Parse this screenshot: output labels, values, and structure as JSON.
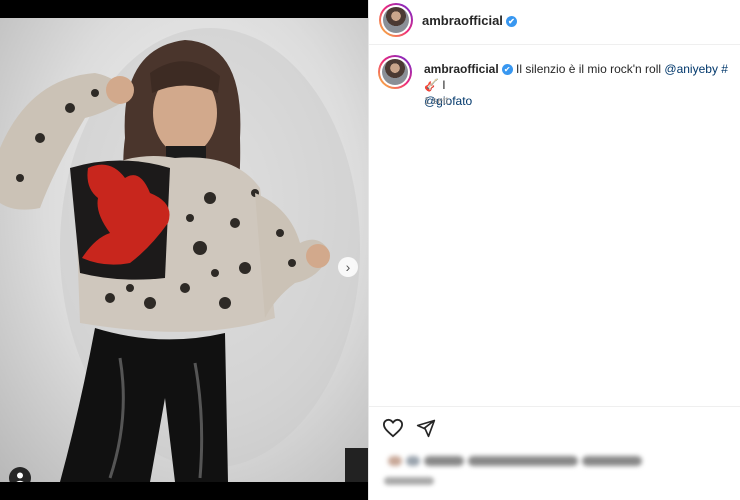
{
  "post": {
    "username": "ambraofficial",
    "verified_icon": "✔",
    "caption_text": "Il silenzio è il mio rock'n roll",
    "mention_1": "@aniyeby",
    "hashtag_start": "#",
    "emoji": "🎸",
    "mention_2": "@giofato",
    "time_ago": "1 sett."
  },
  "carousel": {
    "next_glyph": "›",
    "dot_count": 2,
    "active_dot": 0
  },
  "icons": {
    "like": "heart-icon",
    "share": "share-icon",
    "user_tag": "user-tag-icon",
    "next": "chevron-right-icon"
  },
  "colors": {
    "link": "#00376b",
    "verified": "#3897f0",
    "story_ring_start": "#f9ce34",
    "story_ring_end": "#6228d7"
  }
}
